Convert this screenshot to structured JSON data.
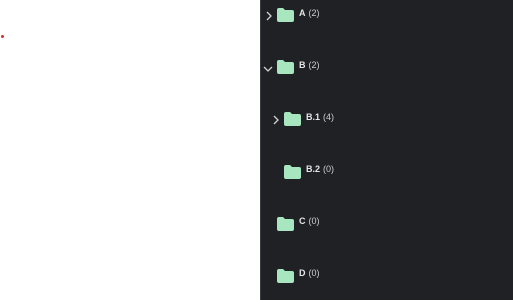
{
  "colors": {
    "panel_bg": "#202124",
    "folder": "#a8e6c0",
    "text": "#e6e6e6"
  },
  "tree": {
    "items": [
      {
        "name": "A",
        "count": "(2)",
        "expanded": false,
        "has_children": true,
        "depth": 0,
        "icon": "chevron-right-icon"
      },
      {
        "name": "B",
        "count": "(2)",
        "expanded": true,
        "has_children": true,
        "depth": 0,
        "icon": "chevron-down-icon"
      },
      {
        "name": "B.1",
        "count": "(4)",
        "expanded": false,
        "has_children": true,
        "depth": 1,
        "icon": "chevron-right-icon"
      },
      {
        "name": "B.2",
        "count": "(0)",
        "expanded": false,
        "has_children": false,
        "depth": 1
      },
      {
        "name": "C",
        "count": "(0)",
        "expanded": false,
        "has_children": false,
        "depth": 0
      },
      {
        "name": "D",
        "count": "(0)",
        "expanded": false,
        "has_children": false,
        "depth": 0
      }
    ]
  }
}
